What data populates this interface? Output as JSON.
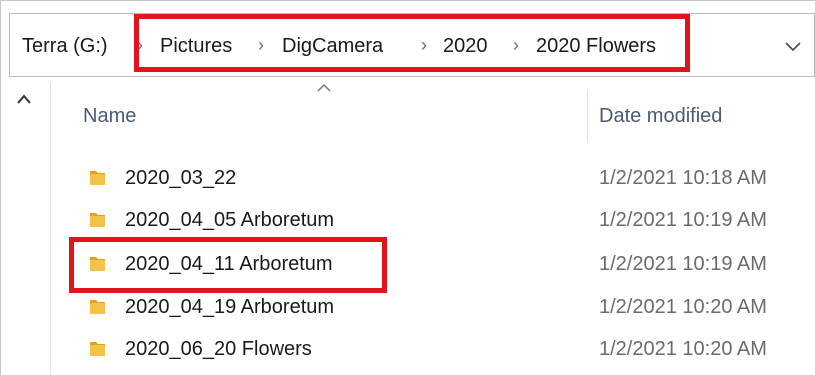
{
  "breadcrumb": {
    "drive": "Terra (G:)",
    "separator": "›",
    "items": [
      "Pictures",
      "DigCamera",
      "2020",
      "2020 Flowers"
    ],
    "dropdown_icon": "chevron-down-icon"
  },
  "columns": {
    "name": "Name",
    "date_modified": "Date modified"
  },
  "files": [
    {
      "name": "2020_03_22",
      "date": "1/2/2021 10:18 AM",
      "type": "folder"
    },
    {
      "name": "2020_04_05 Arboretum",
      "date": "1/2/2021 10:19 AM",
      "type": "folder"
    },
    {
      "name": "2020_04_11 Arboretum",
      "date": "1/2/2021 10:19 AM",
      "type": "folder",
      "highlighted": true
    },
    {
      "name": "2020_04_19 Arboretum",
      "date": "1/2/2021 10:20 AM",
      "type": "folder"
    },
    {
      "name": "2020_06_20 Flowers",
      "date": "1/2/2021 10:20 AM",
      "type": "folder"
    }
  ],
  "colors": {
    "highlight": "#e0151b",
    "folder": "#f5c34a",
    "header_text": "#4a5b75"
  }
}
